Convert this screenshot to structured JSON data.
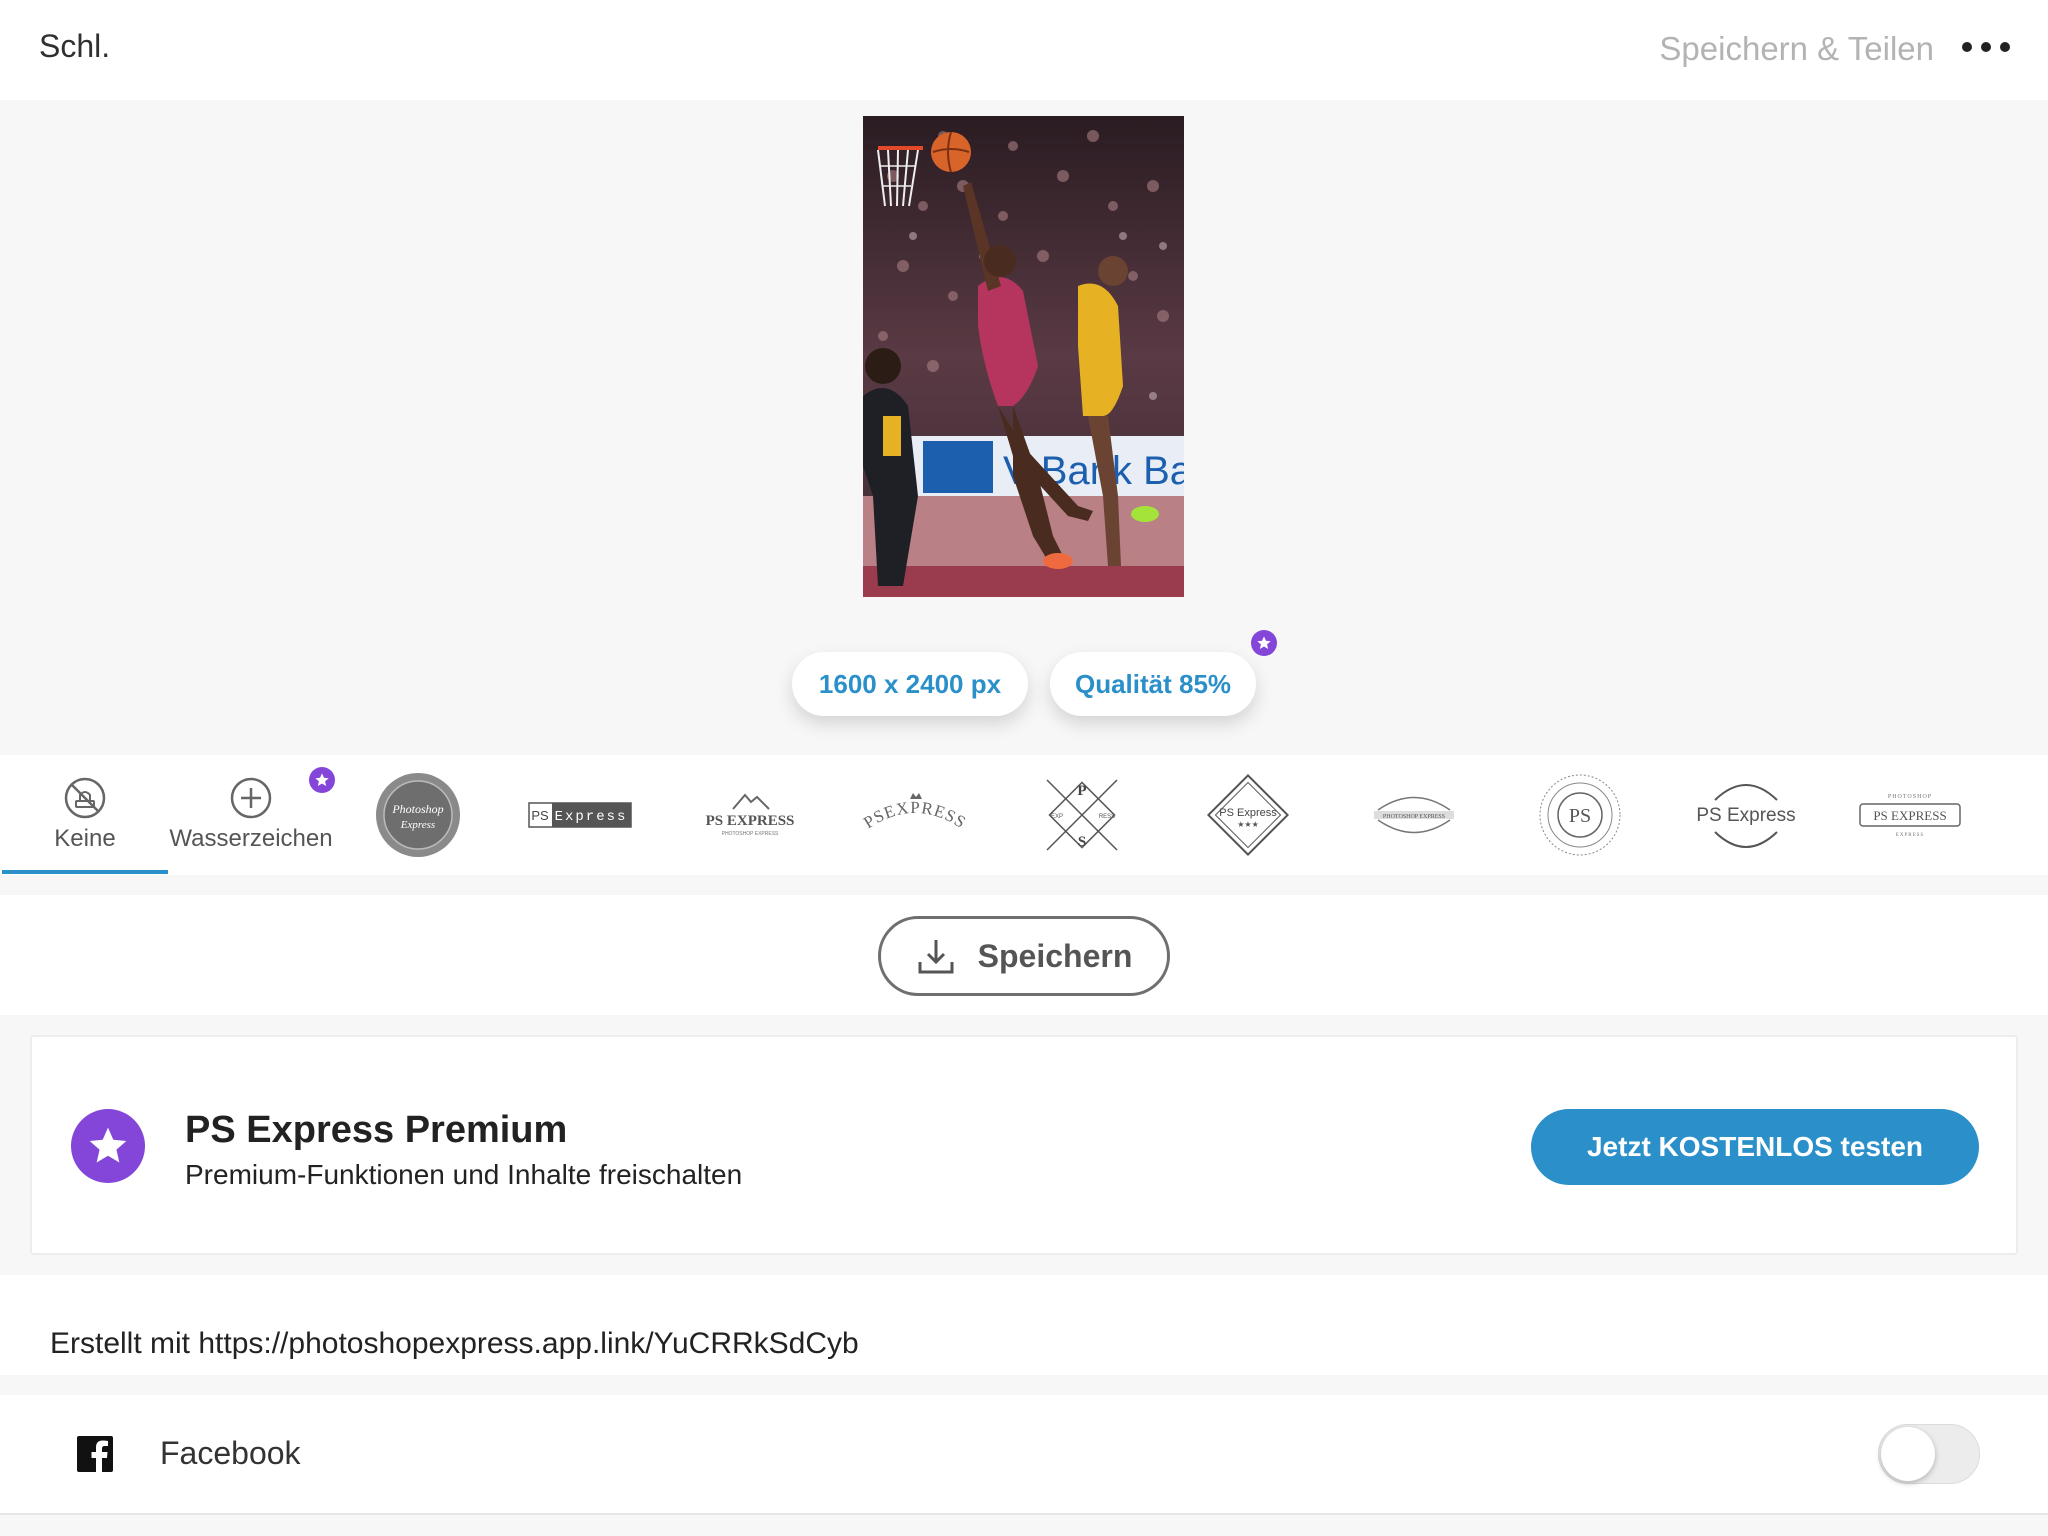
{
  "header": {
    "close_label": "Schl.",
    "title": "Speichern & Teilen",
    "more_icon": "more-horizontal-icon"
  },
  "preview": {
    "size_label": "1600 x 2400 px",
    "quality_label": "Qualität 85%",
    "photo_banner_text": "V Bank Ba"
  },
  "watermarks": {
    "items": [
      {
        "label": "Keine",
        "icon": "no-watermark-icon",
        "selected": true
      },
      {
        "label": "Wasserzeichen",
        "icon": "add-icon",
        "premium": true
      },
      {
        "style": "badge-seal",
        "text_top": "Photoshop",
        "text_bottom": "Express"
      },
      {
        "style": "block",
        "text_left": "PS",
        "text_right": "Express"
      },
      {
        "style": "mountain",
        "text": "PS EXPRESS",
        "subtext": "PHOTOSHOP EXPRESS"
      },
      {
        "style": "arc",
        "text": "PSEXPRESS"
      },
      {
        "style": "diamond-arrows",
        "text_top": "P",
        "text_bottom": "S",
        "text_left": "EXP",
        "text_right": "RESS"
      },
      {
        "style": "diamond",
        "text": "PS Express",
        "stars": "★★★"
      },
      {
        "style": "oval",
        "text": "PHOTOSHOP EXPRESS"
      },
      {
        "style": "circle",
        "text": "PS"
      },
      {
        "style": "arcs",
        "text": "PS Express"
      },
      {
        "style": "frame",
        "text_top": "PHOTOSHOP",
        "text": "PS EXPRESS",
        "text_bottom": "EXPRESS"
      }
    ]
  },
  "save": {
    "label": "Speichern",
    "icon": "download-icon"
  },
  "premium": {
    "title": "PS Express Premium",
    "subtitle": "Premium-Funktionen und Inhalte freischalten",
    "cta": "Jetzt KOSTENLOS testen",
    "icon": "star-icon"
  },
  "caption": {
    "text": "Erstellt mit https://photoshopexpress.app.link/YuCRRkSdCyb"
  },
  "share": {
    "facebook_label": "Facebook",
    "facebook_enabled": false
  },
  "colors": {
    "accent": "#2b90c9",
    "premium": "#8346d9"
  }
}
